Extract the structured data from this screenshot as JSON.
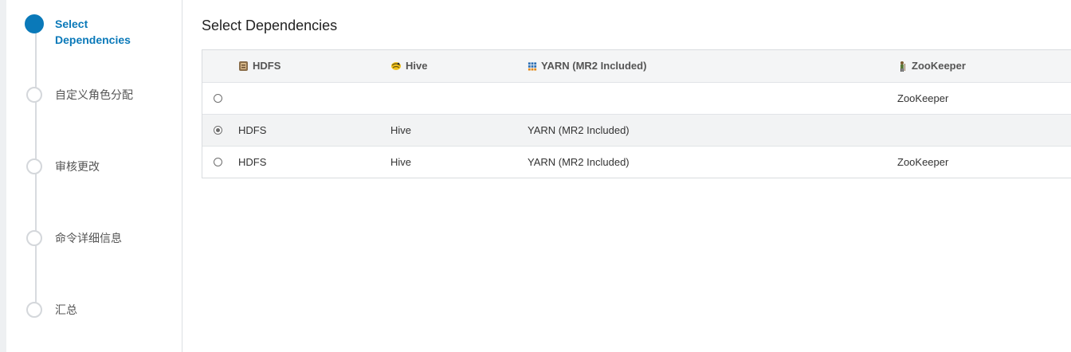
{
  "wizard": {
    "steps": [
      {
        "label": "Select Dependencies",
        "active": true
      },
      {
        "label": "自定义角色分配",
        "active": false
      },
      {
        "label": "审核更改",
        "active": false
      },
      {
        "label": "命令详细信息",
        "active": false
      },
      {
        "label": "汇总",
        "active": false
      }
    ]
  },
  "main": {
    "title": "Select Dependencies",
    "table": {
      "headers": {
        "hdfs": "HDFS",
        "hive": "Hive",
        "yarn": "YARN (MR2 Included)",
        "zookeeper": "ZooKeeper"
      },
      "header_icons": {
        "hdfs": "hdfs-icon",
        "hive": "hive-icon",
        "yarn": "yarn-icon",
        "zookeeper": "zookeeper-icon"
      },
      "rows": [
        {
          "selected": false,
          "hdfs": "",
          "hive": "",
          "yarn": "",
          "zookeeper": "ZooKeeper"
        },
        {
          "selected": true,
          "hdfs": "HDFS",
          "hive": "Hive",
          "yarn": "YARN (MR2 Included)",
          "zookeeper": ""
        },
        {
          "selected": false,
          "hdfs": "HDFS",
          "hive": "Hive",
          "yarn": "YARN (MR2 Included)",
          "zookeeper": "ZooKeeper"
        }
      ]
    }
  },
  "colors": {
    "accent": "#0a79b9"
  }
}
